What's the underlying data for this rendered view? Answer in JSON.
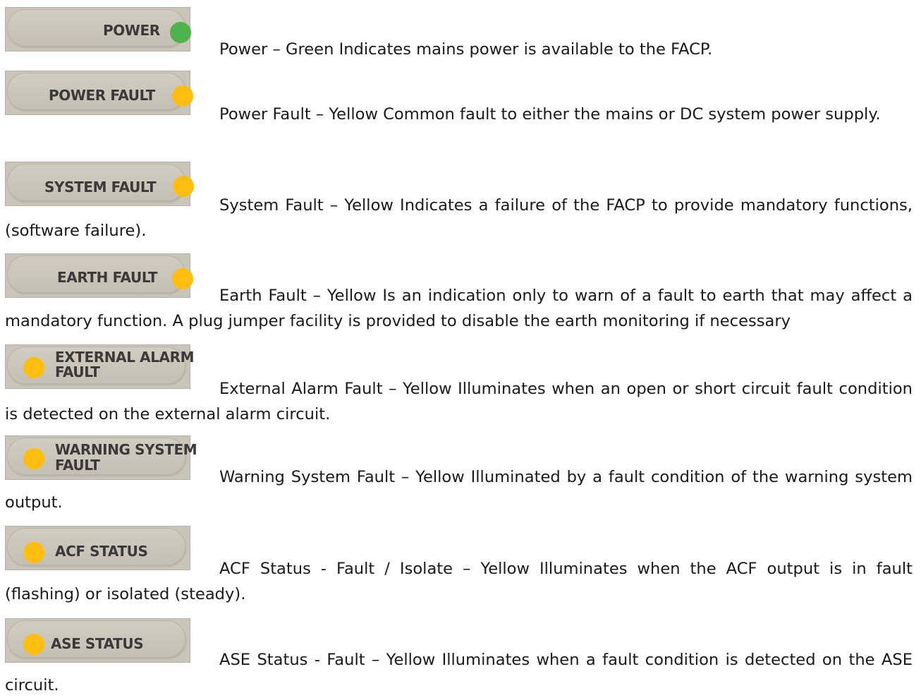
{
  "colors": {
    "green": "#4db34a",
    "yellow": "#ffbd10",
    "panel": "#c9c5b8"
  },
  "items": [
    {
      "label": "POWER",
      "label2": "",
      "led": "green",
      "text": "Power – Green Indicates mains power is available to the FACP."
    },
    {
      "label": "POWER FAULT",
      "label2": "",
      "led": "yellow",
      "text": "Power Fault – Yellow Common fault to either the mains or DC system power supply."
    },
    {
      "label": "SYSTEM FAULT",
      "label2": "",
      "led": "yellow",
      "text": "System Fault – Yellow Indicates a failure of the FACP to provide mandatory functions, (software failure)."
    },
    {
      "label": "EARTH FAULT",
      "label2": "",
      "led": "yellow",
      "text": "Earth Fault – Yellow Is an indication only to warn of a fault to earth that may affect a mandatory function. A plug jumper facility is provided to disable the earth monitoring if necessary"
    },
    {
      "label": "EXTERNAL ALARM",
      "label2": "FAULT",
      "led": "yellow",
      "text": "External Alarm Fault – Yellow Illuminates when an open or short circuit fault condition is detected on the external alarm circuit."
    },
    {
      "label": "WARNING SYSTEM",
      "label2": "FAULT",
      "led": "yellow",
      "text": "Warning System Fault  – Yellow Illuminated by a fault condition of the warning system output."
    },
    {
      "label": "ACF STATUS",
      "label2": "",
      "led": "yellow",
      "text": "ACF Status - Fault / Isolate – Yellow Illuminates when the ACF output is in fault (flashing) or isolated (steady)."
    },
    {
      "label": "ASE STATUS",
      "label2": "",
      "led": "yellow",
      "text": "ASE Status - Fault – Yellow Illuminates when a fault condition is detected on the ASE circuit."
    }
  ]
}
